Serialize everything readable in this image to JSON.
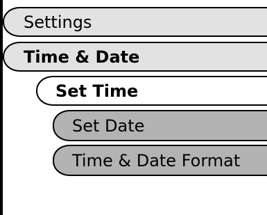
{
  "menu": {
    "items": [
      {
        "label": "Settings"
      },
      {
        "label": "Time & Date"
      },
      {
        "label": "Set Time"
      },
      {
        "label": "Set Date"
      },
      {
        "label": "Time & Date Format"
      }
    ]
  },
  "colors": {
    "light_pill": "#e2e2e2",
    "selected_pill": "#ffffff",
    "dark_pill": "#b3b3b3",
    "outline": "#000000"
  }
}
